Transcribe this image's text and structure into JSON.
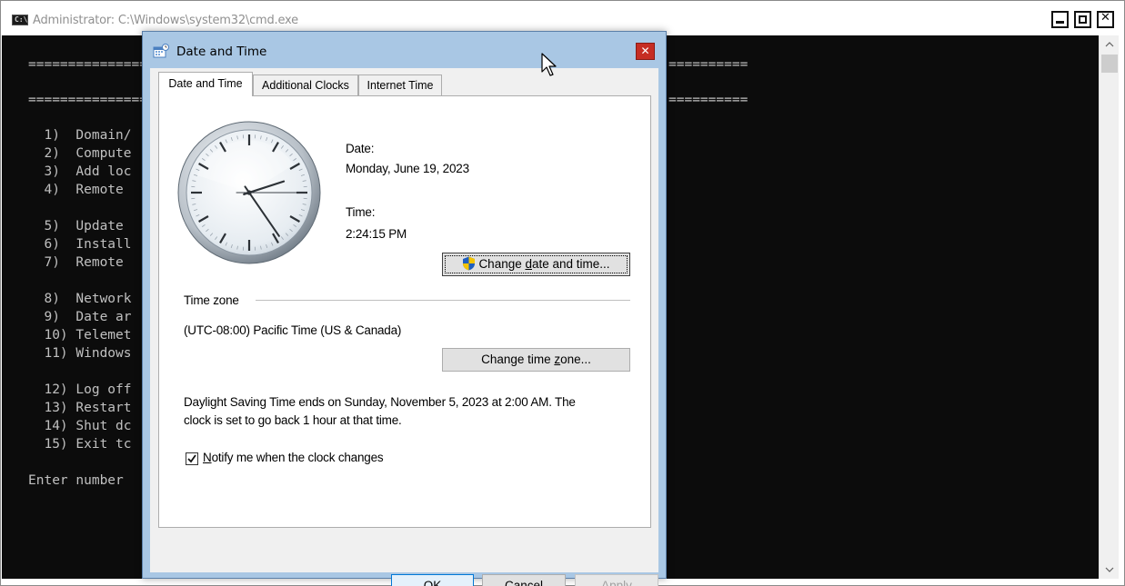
{
  "cmd": {
    "title": "Administrator: C:\\Windows\\system32\\cmd.exe",
    "icon_label": "C:\\",
    "lines": [
      "===============",
      "===============",
      "  1)  Domain/",
      "  2)  Compute",
      "  3)  Add loc",
      "  4)  Remote",
      "  5)  Update",
      "  6)  Install",
      "  7)  Remote",
      "  8)  Network",
      "  9)  Date ar",
      "  10) Telemet",
      "  11) Windows",
      "  12) Log off",
      "  13) Restart",
      "  14) Shut dc",
      "  15) Exit tc",
      "Enter number"
    ],
    "right_rules": [
      "==========",
      "=========="
    ],
    "scroll_up": "^",
    "scroll_down": "v"
  },
  "dialog": {
    "title": "Date and Time",
    "close_glyph": "✕",
    "tabs": [
      "Date and Time",
      "Additional Clocks",
      "Internet Time"
    ],
    "date_label": "Date:",
    "date_value": "Monday, June 19, 2023",
    "time_label": "Time:",
    "time_value": "2:24:15 PM",
    "change_date_button": {
      "pre": "Change ",
      "accel": "d",
      "post": "ate and time..."
    },
    "timezone_heading": "Time zone",
    "timezone_value": "(UTC-08:00) Pacific Time (US & Canada)",
    "change_tz_button": {
      "pre": "Change time ",
      "accel": "z",
      "post": "one..."
    },
    "dst_line1": "Daylight Saving Time ends on Sunday, November 5, 2023 at 2:00 AM. The",
    "dst_line2": "clock is set to go back 1 hour at that time.",
    "notify": {
      "accel": "N",
      "post": "otify me when the clock changes",
      "checked": true
    },
    "ok_label": "OK",
    "cancel_label": "Cancel",
    "apply": {
      "accel": "A",
      "post": "pply"
    }
  },
  "clock_time": {
    "hour": 2,
    "minute": 24,
    "second": 15
  },
  "colors": {
    "console_bg": "#0c0c0c",
    "console_text": "#c0c0c0",
    "dialog_frame": "#a9c7e4",
    "close_red": "#c62d23",
    "shield_blue": "#1f5fbf",
    "shield_yellow": "#f5c400"
  },
  "icons": [
    "cmd-icon",
    "date-time-icon",
    "close-icon",
    "minimize-icon",
    "maximize-icon",
    "uac-shield-icon",
    "checkmark-icon",
    "mouse-cursor-icon",
    "scroll-up-icon",
    "scroll-down-icon"
  ]
}
